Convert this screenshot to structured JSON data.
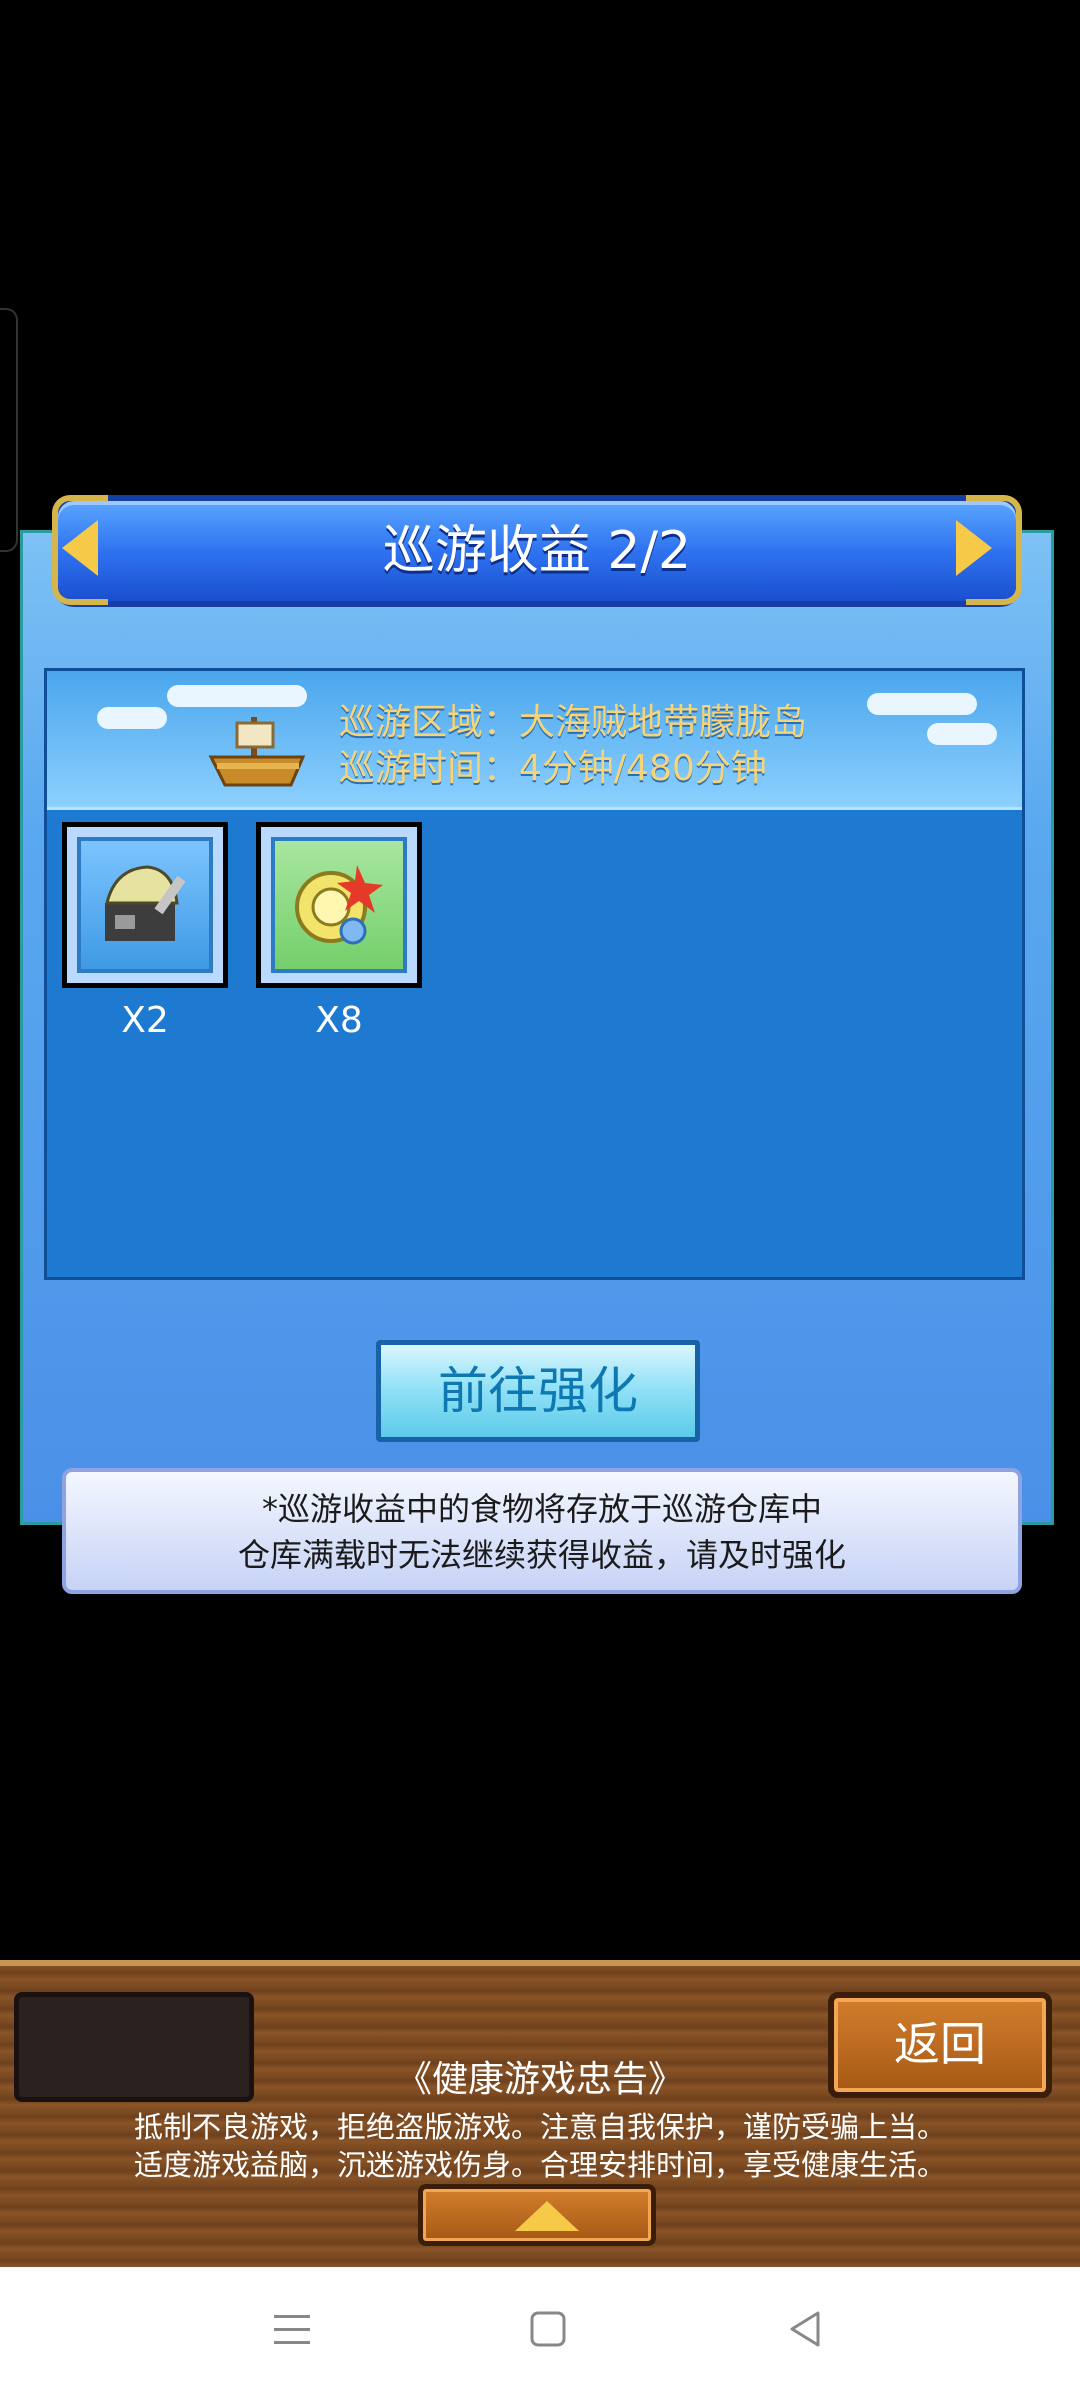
{
  "title": "巡游收益 2/2",
  "info": {
    "region": "巡游区域：大海贼地带朦胧岛",
    "time": "巡游时间：4分钟/480分钟"
  },
  "items": [
    {
      "icon": "helmet-shield-icon",
      "count": "X2"
    },
    {
      "icon": "gold-coin-icon",
      "count": "X8"
    }
  ],
  "enhance_button": "前往强化",
  "note": {
    "line1": "*巡游收益中的食物将存放于巡游仓库中",
    "line2": "仓库满载时无法继续获得收益，请及时强化"
  },
  "back_button": "返回",
  "health_notice": {
    "title": "《健康游戏忠告》",
    "line1": "抵制不良游戏，拒绝盗版游戏。注意自我保护，谨防受骗上当。",
    "line2": "适度游戏益脑，沉迷游戏伤身。合理安排时间，享受健康生活。"
  },
  "colors": {
    "title_bar": "#2f73f0",
    "gold_accent": "#f7c948",
    "info_text": "#f6d47a"
  }
}
